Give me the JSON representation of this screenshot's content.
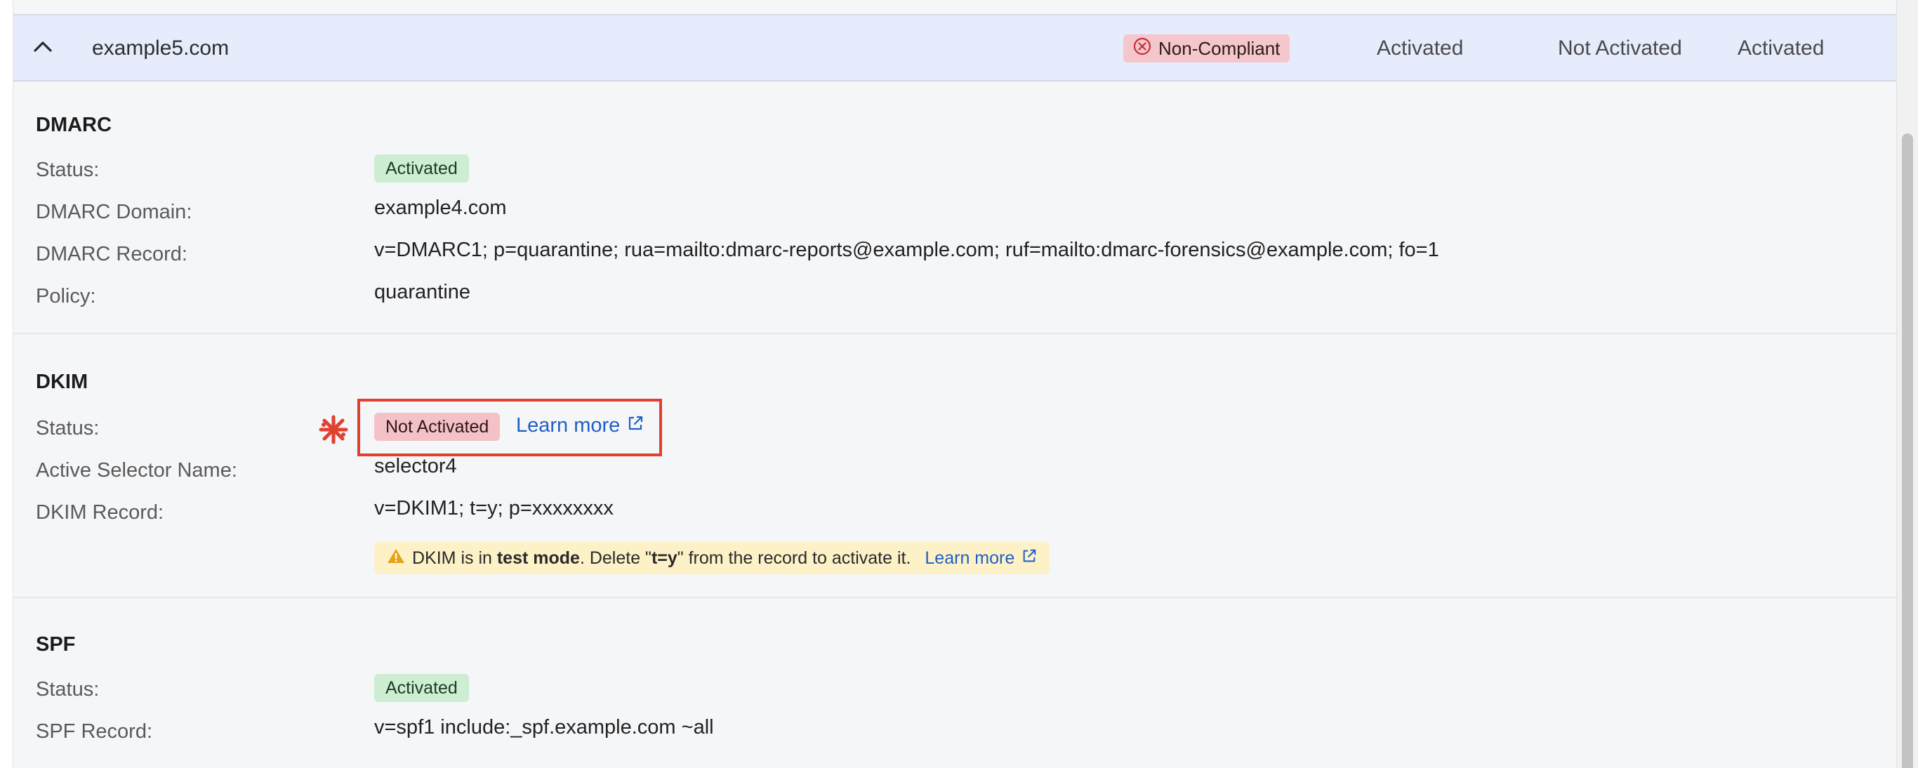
{
  "header": {
    "domain": "example5.com",
    "compliance": "Non-Compliant",
    "col1": "Activated",
    "col2": "Not Activated",
    "col3": "Activated"
  },
  "dmarc": {
    "title": "DMARC",
    "status_label": "Status:",
    "status_value": "Activated",
    "domain_label": "DMARC Domain:",
    "domain_value": "example4.com",
    "record_label": "DMARC Record:",
    "record_value": "v=DMARC1; p=quarantine; rua=mailto:dmarc-reports@example.com; ruf=mailto:dmarc-forensics@example.com; fo=1",
    "policy_label": "Policy:",
    "policy_value": "quarantine"
  },
  "dkim": {
    "title": "DKIM",
    "status_label": "Status:",
    "status_value": "Not Activated",
    "learn_more": "Learn more",
    "selector_label": "Active Selector Name:",
    "selector_value": "selector4",
    "record_label": "DKIM Record:",
    "record_value": "v=DKIM1; t=y; p=xxxxxxxx",
    "warning": {
      "prefix": "DKIM is in ",
      "bold1": "test mode",
      "middle": ". Delete \"",
      "bold2": "t=y",
      "suffix": "\" from the record to activate it.",
      "learn_more": "Learn more"
    }
  },
  "spf": {
    "title": "SPF",
    "status_label": "Status:",
    "status_value": "Activated",
    "record_label": "SPF Record:",
    "record_value": "v=spf1 include:_spf.example.com ~all"
  },
  "colors": {
    "header_bg": "#e6ecfb",
    "success_badge": "#cdeed3",
    "error_badge": "#f3c1c6",
    "link": "#1f5fc6",
    "highlight": "#e0402f",
    "warning_bg": "#fdf1c8"
  },
  "icons": {
    "collapse": "chevron-up-icon",
    "compliance": "x-circle-icon",
    "external": "external-link-icon",
    "warning": "warning-triangle-icon",
    "annotation": "asterisk-mark-icon"
  }
}
